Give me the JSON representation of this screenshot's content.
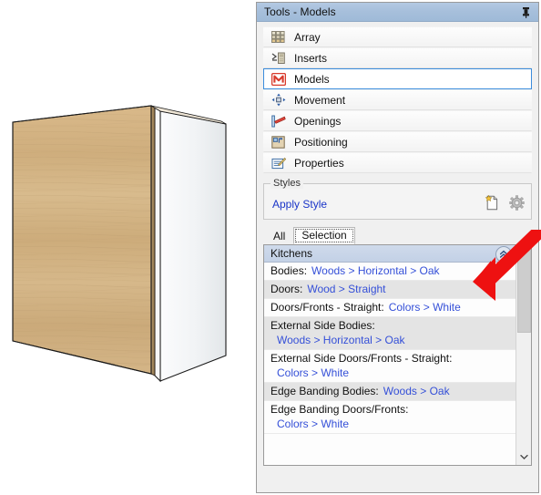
{
  "panel": {
    "title": "Tools - Models",
    "pin_icon": "pushpin-icon"
  },
  "nav": {
    "items": [
      {
        "label": "Array",
        "icon": "array-grid-icon",
        "selected": false
      },
      {
        "label": "Inserts",
        "icon": "inserts-icon",
        "selected": false
      },
      {
        "label": "Models",
        "icon": "models-m-icon",
        "selected": true
      },
      {
        "label": "Movement",
        "icon": "movement-arrows-icon",
        "selected": false
      },
      {
        "label": "Openings",
        "icon": "openings-icon",
        "selected": false
      },
      {
        "label": "Positioning",
        "icon": "positioning-icon",
        "selected": false
      },
      {
        "label": "Properties",
        "icon": "properties-icon",
        "selected": false
      }
    ]
  },
  "styles": {
    "legend": "Styles",
    "apply_link": "Apply Style",
    "new_style_icon": "new-style-document-icon",
    "settings_icon": "gear-icon"
  },
  "tabs": [
    {
      "label": "All",
      "active": false
    },
    {
      "label": "Selection",
      "active": true
    }
  ],
  "list": {
    "group_title": "Kitchens",
    "collapse_icon": "chevron-double-up-icon",
    "rows": [
      {
        "label": "Bodies:",
        "value": "Woods > Horizontal > Oak",
        "two_line": false,
        "alt": false
      },
      {
        "label": "Doors:",
        "value": "Wood > Straight",
        "two_line": false,
        "alt": true
      },
      {
        "label": "Doors/Fronts - Straight:",
        "value": "Colors > White",
        "two_line": false,
        "alt": false
      },
      {
        "label": "External Side Bodies:",
        "value": "Woods > Horizontal > Oak",
        "two_line": true,
        "alt": true
      },
      {
        "label": "External Side Doors/Fronts - Straight:",
        "value": "Colors > White",
        "two_line": true,
        "alt": false
      },
      {
        "label": "Edge Banding Bodies:",
        "value": "Woods > Oak",
        "two_line": false,
        "alt": true
      },
      {
        "label": "Edge Banding Doors/Fronts:",
        "value": "Colors > White",
        "two_line": true,
        "alt": false
      }
    ],
    "scroll_down_icon": "chevron-down-icon"
  },
  "annotation": {
    "arrow_icon": "red-arrow-pointer",
    "arrow_color": "#ee1111",
    "points_at": "collapse-group-button"
  },
  "viewport": {
    "model_name": "kitchen-wall-cabinet",
    "side_material": "Woods > Horizontal > Oak",
    "front_material": "Colors > White"
  },
  "colors": {
    "titlebar": "#a6bfdb",
    "group_header": "#c3d1e6",
    "link": "#3550d8",
    "selection_border": "#3c8ddc",
    "row_alt": "#e4e4e4"
  }
}
